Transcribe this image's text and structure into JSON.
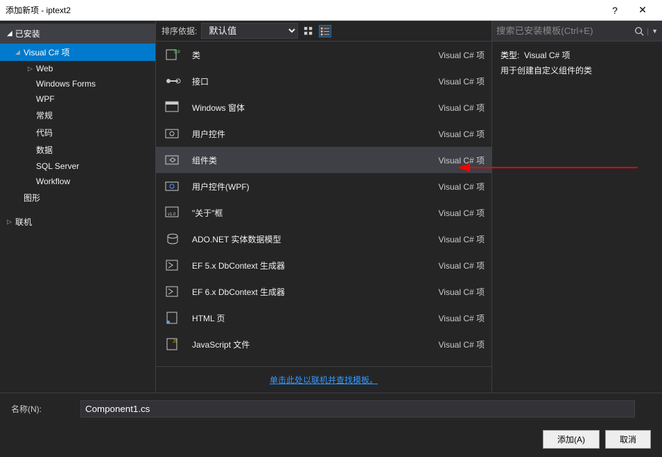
{
  "window": {
    "title": "添加新项 - iptext2",
    "help": "?",
    "close": "✕"
  },
  "tree": {
    "root": "已安装",
    "selected": "Visual C# 项",
    "items": [
      {
        "label": "Web",
        "indent": 2,
        "expandable": true
      },
      {
        "label": "Windows Forms",
        "indent": 2
      },
      {
        "label": "WPF",
        "indent": 2
      },
      {
        "label": "常规",
        "indent": 2
      },
      {
        "label": "代码",
        "indent": 2
      },
      {
        "label": "数据",
        "indent": 2
      },
      {
        "label": "SQL Server",
        "indent": 2
      },
      {
        "label": "Workflow",
        "indent": 2
      },
      {
        "label": "图形",
        "indent": 1
      }
    ],
    "online": "联机"
  },
  "toolbar": {
    "sort_label": "排序依据:",
    "sort_value": "默认值"
  },
  "search": {
    "placeholder": "搜索已安装模板(Ctrl+E)"
  },
  "templates": {
    "lang": "Visual C# 项",
    "items": [
      {
        "name": "类",
        "icon": "class"
      },
      {
        "name": "接口",
        "icon": "interface"
      },
      {
        "name": "Windows 窗体",
        "icon": "form"
      },
      {
        "name": "用户控件",
        "icon": "usercontrol"
      },
      {
        "name": "组件类",
        "icon": "component",
        "selected": true
      },
      {
        "name": "用户控件(WPF)",
        "icon": "usercontrol-wpf"
      },
      {
        "name": "\"关于\"框",
        "icon": "about"
      },
      {
        "name": "ADO.NET 实体数据模型",
        "icon": "ado"
      },
      {
        "name": "EF 5.x DbContext 生成器",
        "icon": "ef"
      },
      {
        "name": "EF 6.x DbContext 生成器",
        "icon": "ef"
      },
      {
        "name": "HTML 页",
        "icon": "html"
      },
      {
        "name": "JavaScript 文件",
        "icon": "js"
      }
    ]
  },
  "link": "单击此处以联机并查找模板。",
  "details": {
    "type_label": "类型:",
    "type_value": "Visual C# 项",
    "description": "用于创建自定义组件的类"
  },
  "filename": {
    "label": "名称(N):",
    "value": "Component1.cs"
  },
  "buttons": {
    "add": "添加(A)",
    "cancel": "取消"
  }
}
